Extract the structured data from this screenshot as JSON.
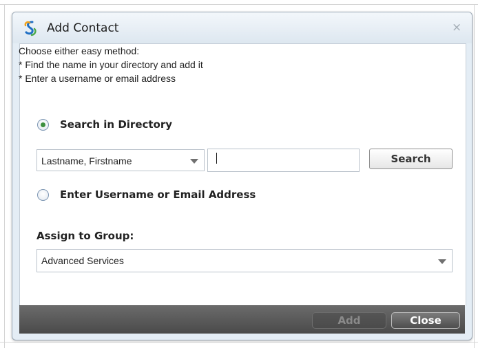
{
  "dialog": {
    "title": "Add Contact",
    "close_glyph": "×",
    "accent_color": "#3d8f3f"
  },
  "intro": {
    "line1": "Choose either easy method:",
    "line2": "* Find the name in your directory and add it",
    "line3": "* Enter a username or email address"
  },
  "options": {
    "search_directory": {
      "label": "Search in Directory",
      "selected": true
    },
    "enter_username": {
      "label": "Enter Username or Email Address",
      "selected": false
    }
  },
  "search": {
    "format_selected": "Lastname, Firstname",
    "input_value": "",
    "button_label": "Search"
  },
  "group": {
    "label": "Assign to Group:",
    "selected": "Advanced Services"
  },
  "footer": {
    "add_label": "Add",
    "add_enabled": false,
    "close_label": "Close"
  },
  "icons": {
    "title_logo": "app-logo-icon",
    "close": "close-icon",
    "dropdown": "chevron-down-icon"
  }
}
